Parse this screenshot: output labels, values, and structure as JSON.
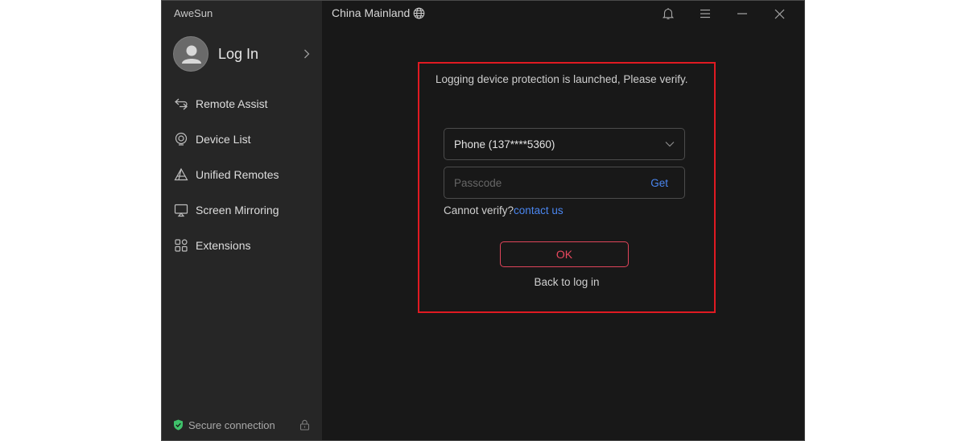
{
  "app": {
    "title": "AweSun"
  },
  "sidebar": {
    "login_label": "Log In",
    "items": [
      {
        "label": "Remote Assist",
        "icon": "remote-assist-icon"
      },
      {
        "label": "Device List",
        "icon": "device-list-icon"
      },
      {
        "label": "Unified Remotes",
        "icon": "unified-remotes-icon"
      },
      {
        "label": "Screen Mirroring",
        "icon": "screen-mirroring-icon"
      },
      {
        "label": "Extensions",
        "icon": "extensions-icon"
      }
    ],
    "secure_label": "Secure connection"
  },
  "header": {
    "region": "China Mainland"
  },
  "verify": {
    "message": "Logging device protection is launched, Please verify.",
    "method_value": "Phone (137****5360)",
    "passcode_placeholder": "Passcode",
    "get_label": "Get",
    "cannot_verify": "Cannot verify?",
    "contact_label": "contact us",
    "ok_label": "OK",
    "back_label": "Back to log in"
  },
  "colors": {
    "accent_blue": "#4a86f0",
    "ok_red": "#e8485e",
    "highlight_red": "#e01a22",
    "secure_green": "#3fc16a"
  }
}
